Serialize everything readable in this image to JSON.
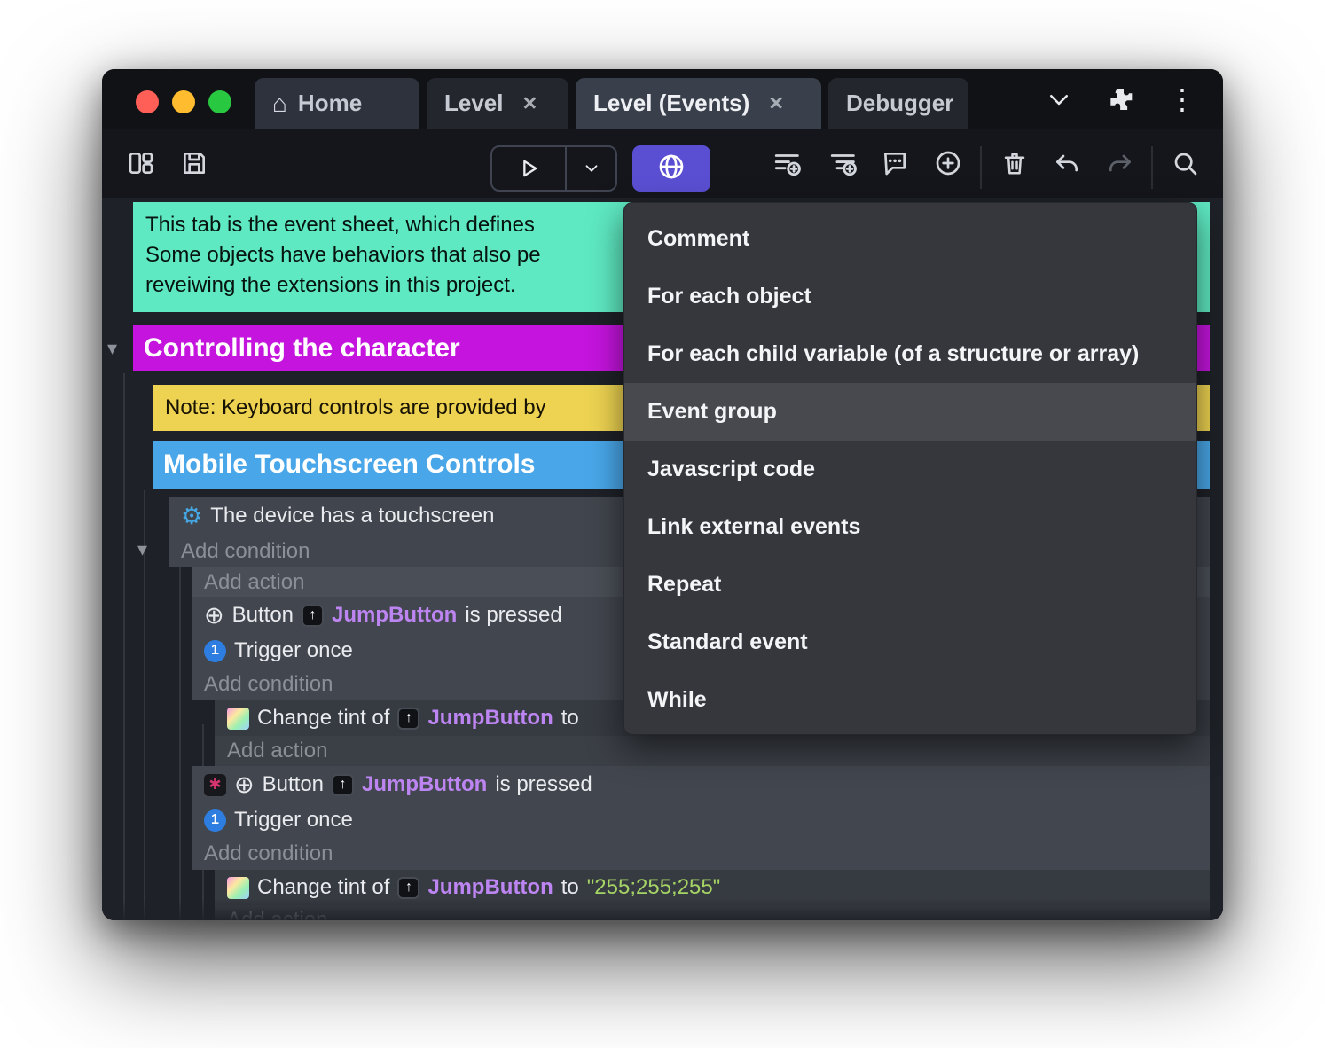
{
  "colors": {
    "accent_purple": "#5a4fd2",
    "comment_green": "#5ee9c2",
    "group_magenta": "#c414dd",
    "note_yellow": "#edd351",
    "group_blue": "#49a7e9",
    "object_purple": "#bd85f2",
    "string_green": "#a5d365",
    "light_red": "#ff5f57",
    "light_yellow": "#febc2e",
    "light_green": "#28c840"
  },
  "titlebar": {
    "tabs": [
      {
        "label": "Home"
      },
      {
        "label": "Level",
        "close": "×"
      },
      {
        "label": "Level (Events)",
        "close": "×"
      },
      {
        "label": "Debugger"
      }
    ]
  },
  "sheet": {
    "comment_lines": [
      "This tab is the event sheet, which defines",
      "Some objects have behaviors that also pe",
      "reveiwing the extensions in this project."
    ],
    "group1": "Controlling the character",
    "note": "Note: Keyboard controls are provided by",
    "group2": "Mobile Touchscreen Controls",
    "cond_touchscreen": "The device has a touchscreen",
    "add_condition": "Add condition",
    "add_action": "Add action",
    "button_label": "Button",
    "jumpbutton": "JumpButton",
    "is_pressed": "is pressed",
    "trigger_once": "Trigger once",
    "trigger_once_badge": "1",
    "change_tint": "Change tint of",
    "to": "to",
    "tint_value": "\"255;255;255\""
  },
  "menu": {
    "items": [
      "Comment",
      "For each object",
      "For each child variable (of a structure or array)",
      "Event group",
      "Javascript code",
      "Link external events",
      "Repeat",
      "Standard event",
      "While"
    ],
    "highlighted": "Event group"
  }
}
